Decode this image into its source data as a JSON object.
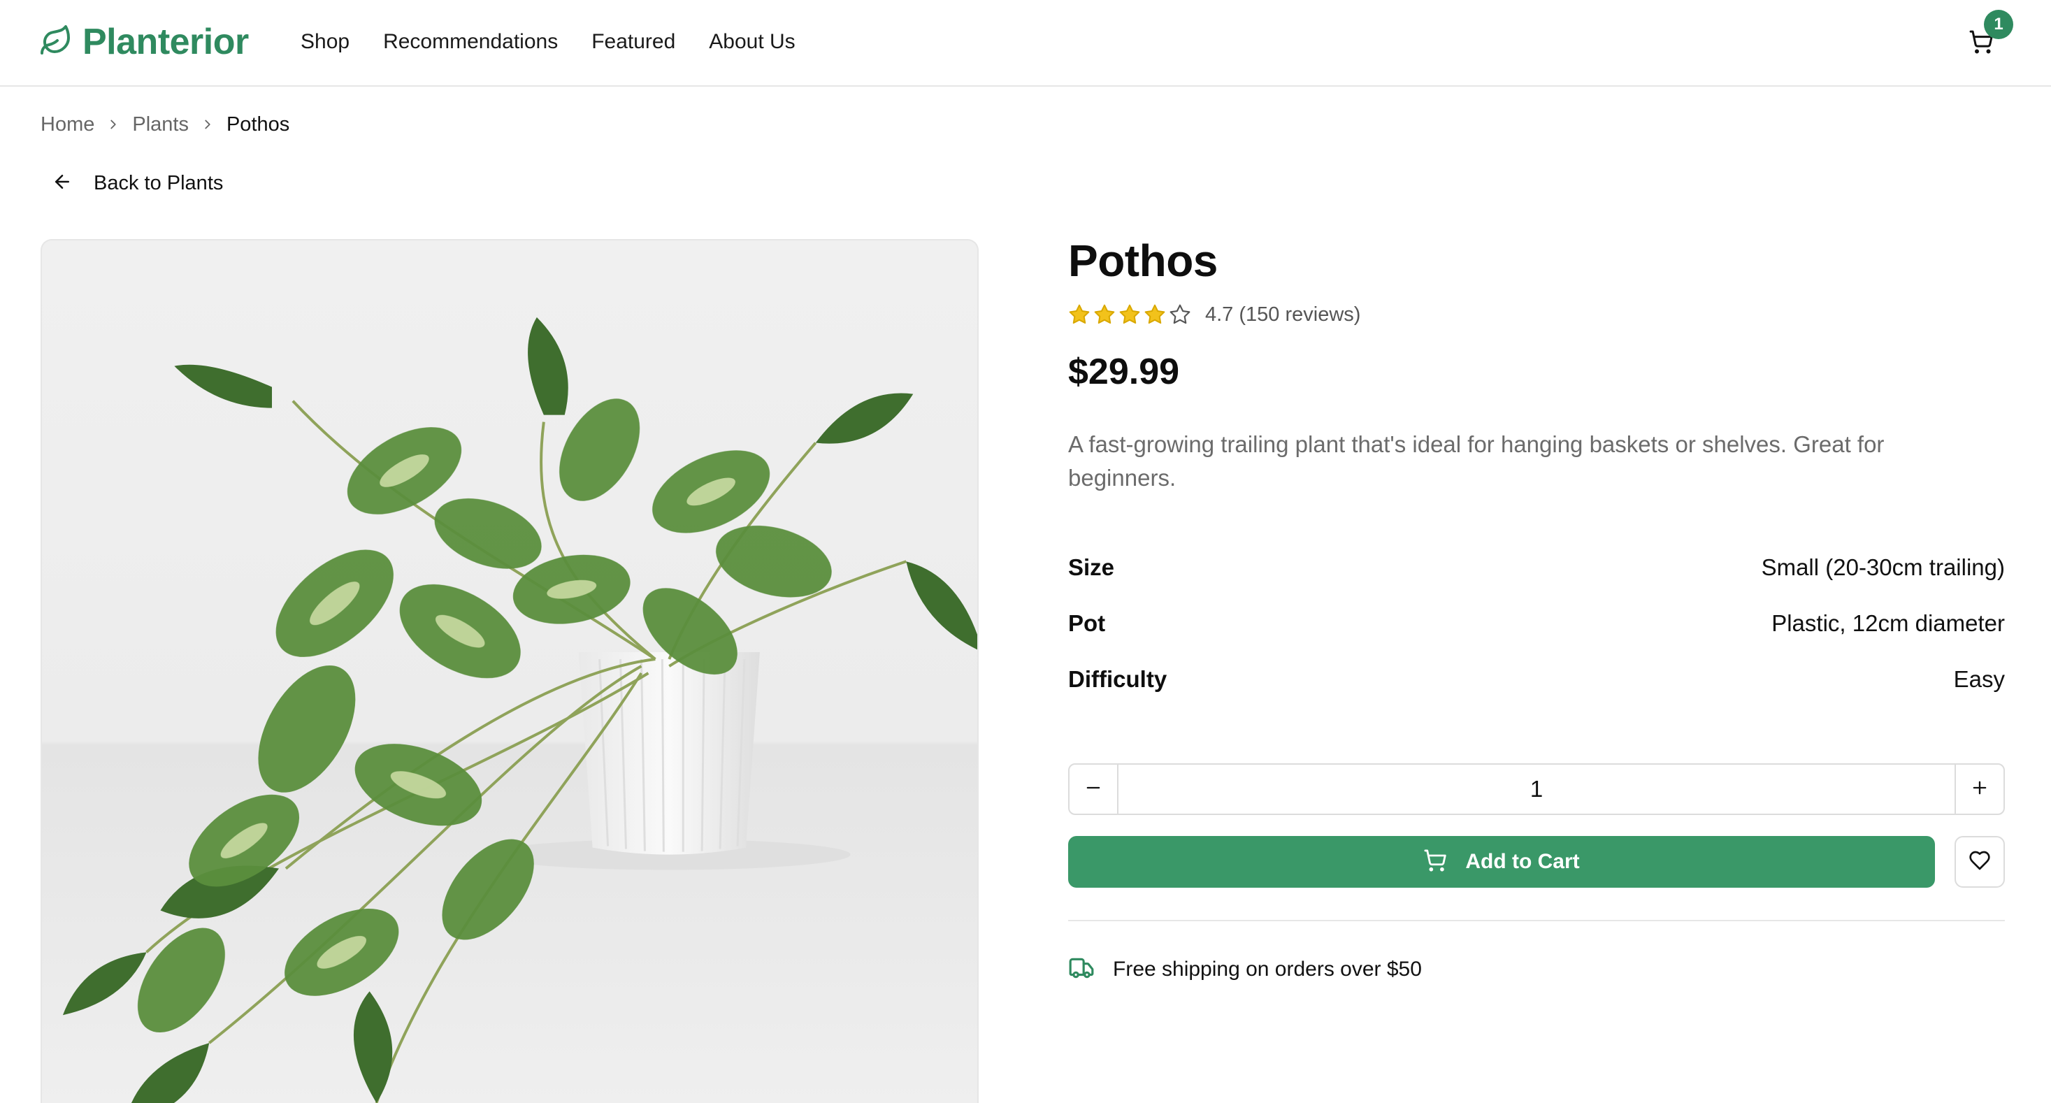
{
  "brand": {
    "name": "Planterior",
    "color": "#2f8a5f"
  },
  "nav": [
    {
      "label": "Shop"
    },
    {
      "label": "Recommendations"
    },
    {
      "label": "Featured"
    },
    {
      "label": "About Us"
    }
  ],
  "cart": {
    "count": "1",
    "icon": "shopping-cart-icon"
  },
  "breadcrumb": [
    {
      "label": "Home"
    },
    {
      "label": "Plants"
    },
    {
      "label": "Pothos"
    }
  ],
  "back": {
    "label": "Back to Plants"
  },
  "product": {
    "name": "Pothos",
    "rating": {
      "stars_filled": 4,
      "stars_total": 5,
      "text": "4.7 (150 reviews)"
    },
    "price": "$29.99",
    "description": "A fast-growing trailing plant that's ideal for hanging baskets or shelves. Great for beginners.",
    "specs": [
      {
        "label": "Size",
        "value": "Small (20-30cm trailing)"
      },
      {
        "label": "Pot",
        "value": "Plastic, 12cm diameter"
      },
      {
        "label": "Difficulty",
        "value": "Easy"
      }
    ]
  },
  "quantity": {
    "value": "1"
  },
  "actions": {
    "add_to_cart": "Add to Cart",
    "accent": "#3a9868"
  },
  "shipping": {
    "text": "Free shipping on orders over $50"
  }
}
